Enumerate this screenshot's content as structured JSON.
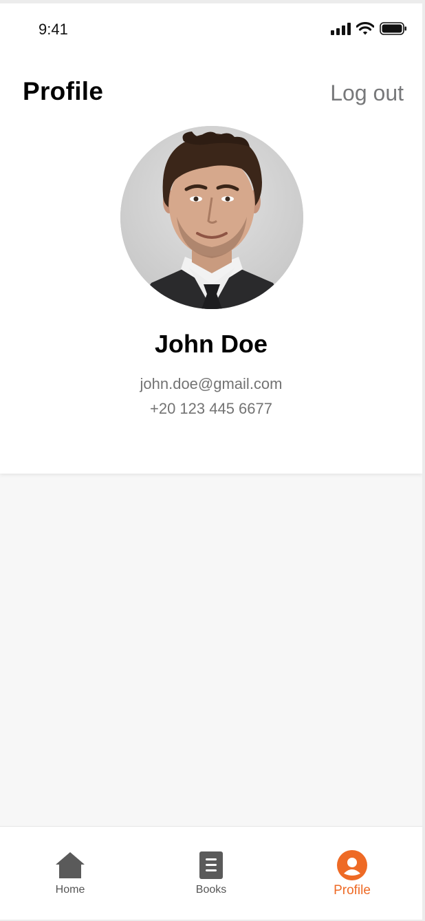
{
  "status_bar": {
    "time": "9:41",
    "icons": [
      "signal-icon",
      "wifi-icon",
      "battery-icon"
    ]
  },
  "header": {
    "title": "Profile",
    "logout_label": "Log out"
  },
  "profile": {
    "name": "John Doe",
    "email": "john.doe@gmail.com",
    "phone": "+20 123 445 6677"
  },
  "tab_bar": {
    "items": [
      {
        "label": "Home",
        "icon": "home-icon",
        "active": false
      },
      {
        "label": "Books",
        "icon": "book-icon",
        "active": false
      },
      {
        "label": "Profile",
        "icon": "user-icon",
        "active": true
      }
    ]
  },
  "colors": {
    "accent": "#ee6a25",
    "inactive_icon": "#5a5a5a",
    "secondary_text": "#737373"
  }
}
